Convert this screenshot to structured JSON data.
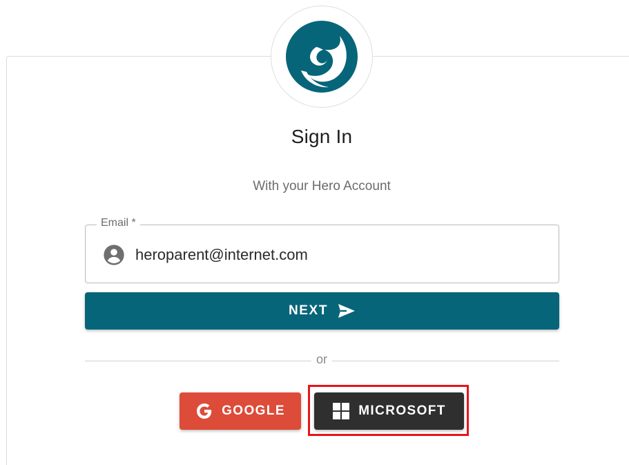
{
  "brand": {
    "logo_icon": "hero-swirl-logo-icon",
    "color": "#076579"
  },
  "header": {
    "title": "Sign In",
    "subtitle": "With your Hero Account"
  },
  "email_field": {
    "label": "Email *",
    "value": "heroparent@internet.com",
    "icon": "account-circle-icon"
  },
  "next_button": {
    "label": "NEXT",
    "icon": "send-arrow-icon",
    "color": "#076579"
  },
  "divider": {
    "text": "or"
  },
  "social": {
    "google_label": "GOOGLE",
    "google_icon": "google-g-icon",
    "google_color": "#dd4b39",
    "microsoft_label": "MICROSOFT",
    "microsoft_icon": "windows-logo-icon",
    "microsoft_color": "#2f2f2f"
  },
  "highlight_color": "#e8141b"
}
